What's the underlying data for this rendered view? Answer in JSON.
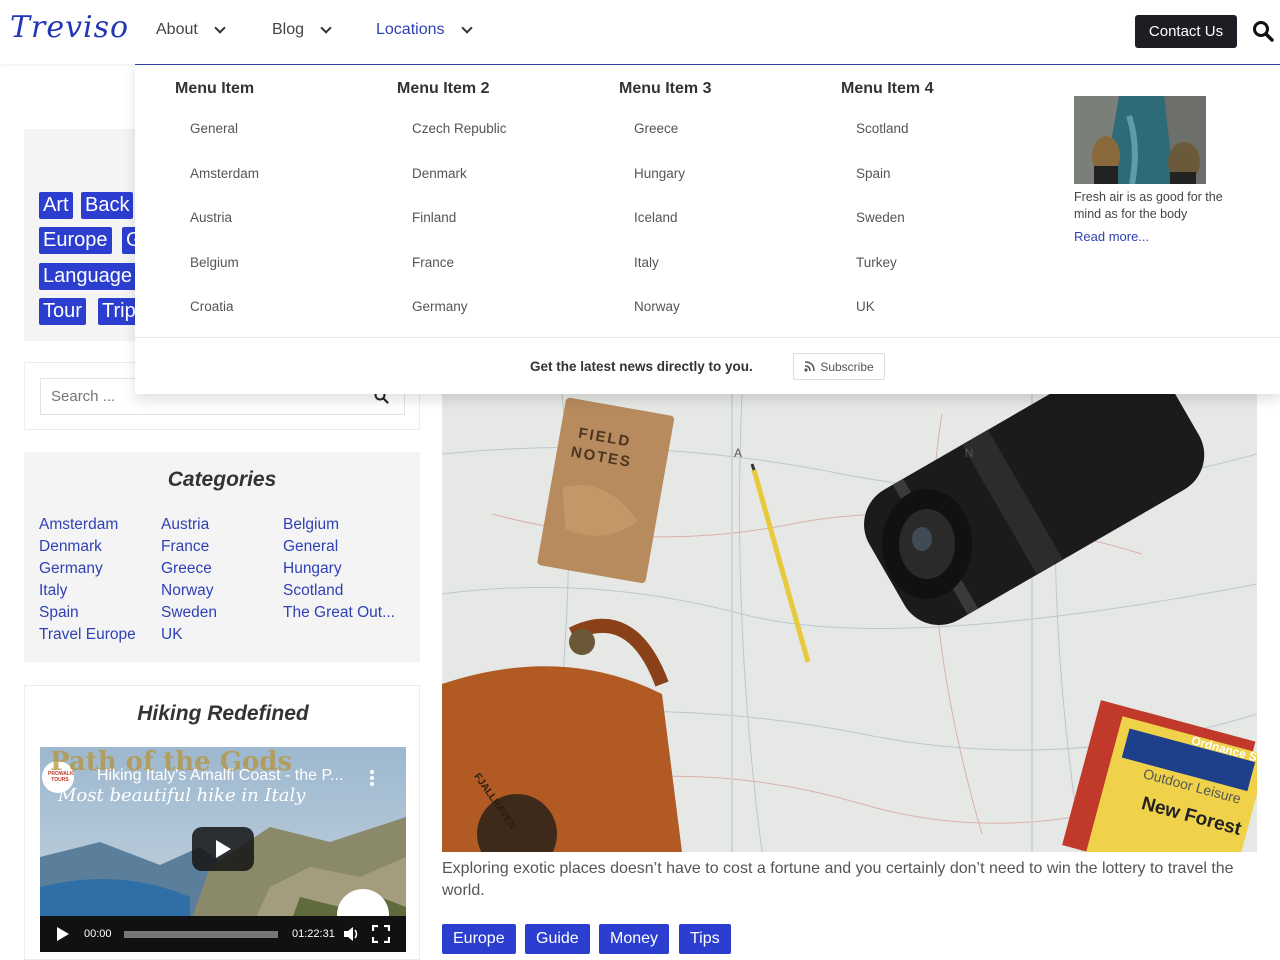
{
  "header": {
    "logo": "Treviso",
    "nav": [
      {
        "label": "About"
      },
      {
        "label": "Blog"
      },
      {
        "label": "Locations"
      }
    ],
    "contact_label": "Contact Us",
    "accent": "#2f41b5"
  },
  "mega_menu": {
    "columns": [
      {
        "heading": "Menu Item",
        "items": [
          "General",
          "Amsterdam",
          "Austria",
          "Belgium",
          "Croatia"
        ]
      },
      {
        "heading": "Menu Item 2",
        "items": [
          "Czech Republic",
          "Denmark",
          "Finland",
          "France",
          "Germany"
        ]
      },
      {
        "heading": "Menu Item 3",
        "items": [
          "Greece",
          "Hungary",
          "Iceland",
          "Italy",
          "Norway"
        ]
      },
      {
        "heading": "Menu Item 4",
        "items": [
          "Scotland",
          "Spain",
          "Sweden",
          "Turkey",
          "UK"
        ]
      }
    ],
    "promo_text": "Fresh air is as good for the mind as for the body",
    "promo_link": "Read more...",
    "newsletter_text": "Get the latest news directly to you.",
    "subscribe_label": "Subscribe"
  },
  "sidebar": {
    "tags": [
      "Art",
      "Back",
      "Europe",
      "G",
      "Language",
      "Tour",
      "Trip"
    ],
    "search_placeholder": "Search ...",
    "categories_title": "Categories",
    "categories": [
      [
        "Amsterdam",
        "Austria",
        "Belgium"
      ],
      [
        "Denmark",
        "France",
        "General"
      ],
      [
        "Germany",
        "Greece",
        "Hungary"
      ],
      [
        "Italy",
        "Norway",
        "Scotland"
      ],
      [
        "Spain",
        "Sweden",
        "The Great Out..."
      ],
      [
        "Travel Europe",
        "UK"
      ]
    ],
    "video_widget_title": "Hiking Redefined",
    "video": {
      "title": "Hiking Italy's Amalfi Coast - the P...",
      "overlay_text": "Path of the Gods",
      "overlay_subtext": "Most beautiful hike in Italy",
      "channel": "PROWALK TOURS",
      "current_time": "00:00",
      "duration": "01:22:31"
    }
  },
  "main": {
    "hero_labels": {
      "notebook": "FIELD NOTES",
      "map_text": "New Forest",
      "map_sub": "Ordnance Survey",
      "map_sub2": "Outdoor Leisure",
      "bag": "FJALLRAVEN",
      "map_letters": "A N"
    },
    "excerpt": "Exploring exotic places doesn’t have to cost a fortune and you certainly don’t need to win the lottery to travel the world.",
    "post_tags": [
      "Europe",
      "Guide",
      "Money",
      "Tips"
    ]
  }
}
